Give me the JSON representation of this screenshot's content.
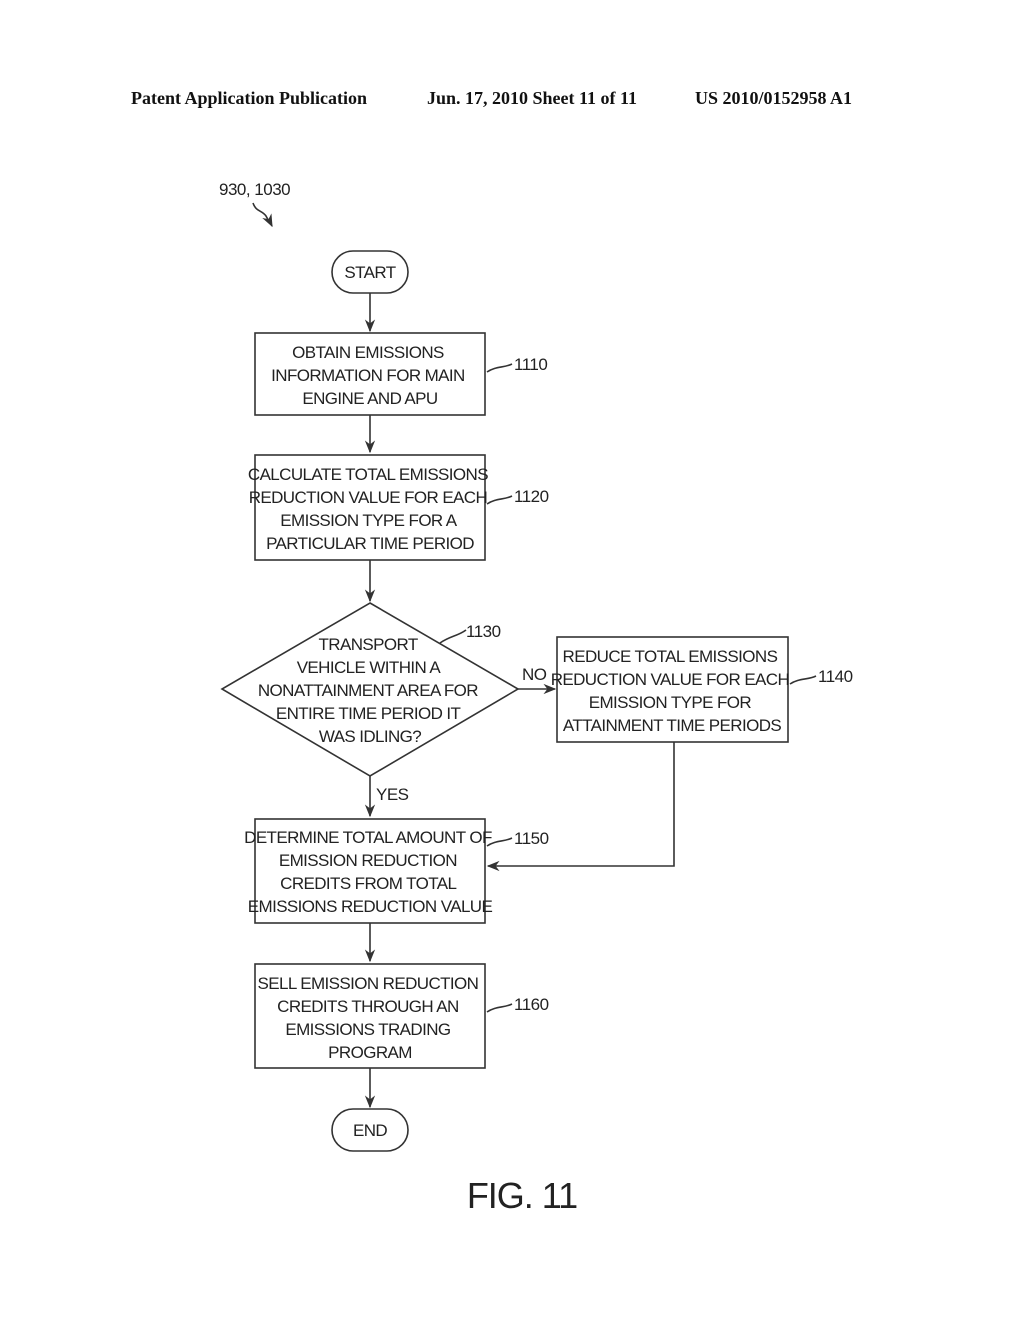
{
  "header": {
    "publication": "Patent Application Publication",
    "date_sheet": "Jun. 17, 2010  Sheet 11 of 11",
    "number": "US 2010/0152958 A1"
  },
  "diagram": {
    "reference": "930, 1030",
    "start": "START",
    "end": "END",
    "steps": [
      {
        "id": "1110",
        "lines": [
          "OBTAIN EMISSIONS",
          "INFORMATION FOR MAIN",
          "ENGINE AND APU"
        ]
      },
      {
        "id": "1120",
        "lines": [
          "CALCULATE TOTAL EMISSIONS",
          "REDUCTION VALUE FOR EACH",
          "EMISSION TYPE FOR A",
          "PARTICULAR TIME PERIOD"
        ]
      },
      {
        "id": "1130",
        "lines": [
          "TRANSPORT",
          "VEHICLE WITHIN A",
          "NONATTAINMENT AREA FOR",
          "ENTIRE TIME PERIOD IT",
          "WAS IDLING?"
        ]
      },
      {
        "id": "1140",
        "lines": [
          "REDUCE TOTAL EMISSIONS",
          "REDUCTION VALUE FOR EACH",
          "EMISSION TYPE FOR",
          "ATTAINMENT TIME PERIODS"
        ]
      },
      {
        "id": "1150",
        "lines": [
          "DETERMINE TOTAL AMOUNT OF",
          "EMISSION REDUCTION",
          "CREDITS FROM TOTAL",
          "EMISSIONS REDUCTION VALUE"
        ]
      },
      {
        "id": "1160",
        "lines": [
          "SELL EMISSION REDUCTION",
          "CREDITS THROUGH AN",
          "EMISSIONS TRADING",
          "PROGRAM"
        ]
      }
    ],
    "branch_no": "NO",
    "branch_yes": "YES",
    "figure_label": "FIG. 11"
  }
}
